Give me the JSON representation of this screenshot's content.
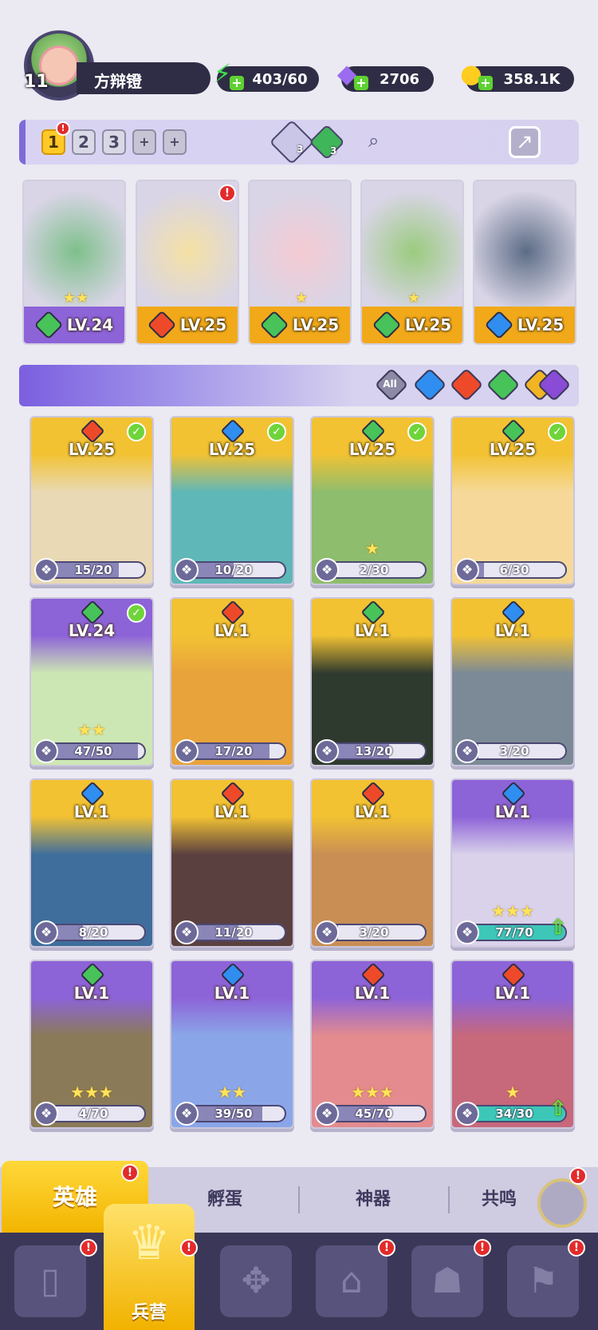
{
  "player": {
    "level": "11",
    "name": "方辩镫"
  },
  "resources": [
    {
      "id": "energy",
      "value": "403/60",
      "icon": "lightning-icon",
      "color": "#3ee04e"
    },
    {
      "id": "gems",
      "value": "2706",
      "icon": "gem-icon",
      "color": "#9a6cf0"
    },
    {
      "id": "gold",
      "value": "358.1K",
      "icon": "coin-icon",
      "color": "#ffcc20"
    }
  ],
  "team": {
    "tabs": [
      "1",
      "2",
      "3",
      "+",
      "+"
    ],
    "active_tab": "1",
    "tab_badge": "!",
    "tickets": [
      {
        "count": "3",
        "color": "#c9c6e8"
      },
      {
        "count": "3",
        "color": "#3fb65a"
      }
    ],
    "members": [
      {
        "level": "LV.24",
        "element": "wind",
        "element_color": "#47c35a",
        "band": "#8d63d8",
        "bg": "#7ec08b",
        "stars": "★★",
        "badge": ""
      },
      {
        "level": "LV.25",
        "element": "fire",
        "element_color": "#ee4a2a",
        "band": "#f1a91a",
        "bg": "#f5e1a4",
        "stars": "",
        "badge": "!"
      },
      {
        "level": "LV.25",
        "element": "wind",
        "element_color": "#47c35a",
        "band": "#f1a91a",
        "bg": "#f5cbd3",
        "stars": "★",
        "badge": ""
      },
      {
        "level": "LV.25",
        "element": "wind",
        "element_color": "#47c35a",
        "band": "#f1a91a",
        "bg": "#9acb7e",
        "stars": "★",
        "badge": ""
      },
      {
        "level": "LV.25",
        "element": "water",
        "element_color": "#2f8ef0",
        "band": "#f1a91a",
        "bg": "#5c6c86",
        "stars": "",
        "badge": ""
      }
    ]
  },
  "filters": [
    {
      "label": "All",
      "color": "#8d8aa6"
    },
    {
      "label": "",
      "color": "#2f8ef0"
    },
    {
      "label": "",
      "color": "#ee4a2a"
    },
    {
      "label": "",
      "color": "#47c35a"
    },
    {
      "label": "",
      "color": "#f1b422"
    },
    {
      "label": "",
      "color": "#8a4bd6"
    }
  ],
  "heroes": [
    {
      "level": "LV.25",
      "element_color": "#ee4a2a",
      "shards": "15/20",
      "progress": 0.75,
      "stars": "",
      "checked": true,
      "upgradeable": false,
      "bg": "#f2c233",
      "art": "#e9d9b4"
    },
    {
      "level": "LV.25",
      "element_color": "#2f8ef0",
      "shards": "10/20",
      "progress": 0.5,
      "stars": "",
      "checked": true,
      "upgradeable": false,
      "bg": "#f2c233",
      "art": "#5fb7b8"
    },
    {
      "level": "LV.25",
      "element_color": "#47c35a",
      "shards": "2/30",
      "progress": 0.07,
      "stars": "★",
      "checked": true,
      "upgradeable": false,
      "bg": "#f2c233",
      "art": "#8ebd6d"
    },
    {
      "level": "LV.25",
      "element_color": "#47c35a",
      "shards": "6/30",
      "progress": 0.2,
      "stars": "",
      "checked": true,
      "upgradeable": false,
      "bg": "#f2c233",
      "art": "#f6d99a"
    },
    {
      "level": "LV.24",
      "element_color": "#47c35a",
      "shards": "47/50",
      "progress": 0.94,
      "stars": "★★",
      "checked": true,
      "upgradeable": false,
      "bg": "#8d63d8",
      "art": "#cde7b4"
    },
    {
      "level": "LV.1",
      "element_color": "#ee4a2a",
      "shards": "17/20",
      "progress": 0.85,
      "stars": "",
      "checked": false,
      "upgradeable": false,
      "bg": "#f2c233",
      "art": "#e8a33b"
    },
    {
      "level": "LV.1",
      "element_color": "#47c35a",
      "shards": "13/20",
      "progress": 0.65,
      "stars": "",
      "checked": false,
      "upgradeable": false,
      "bg": "#f2c233",
      "art": "#2f3a2e"
    },
    {
      "level": "LV.1",
      "element_color": "#2f8ef0",
      "shards": "3/20",
      "progress": 0.15,
      "stars": "",
      "checked": false,
      "upgradeable": false,
      "bg": "#f2c233",
      "art": "#7c8a97"
    },
    {
      "level": "LV.1",
      "element_color": "#2f8ef0",
      "shards": "8/20",
      "progress": 0.4,
      "stars": "",
      "checked": false,
      "upgradeable": false,
      "bg": "#f2c233",
      "art": "#3f6e9c"
    },
    {
      "level": "LV.1",
      "element_color": "#ee4a2a",
      "shards": "11/20",
      "progress": 0.55,
      "stars": "",
      "checked": false,
      "upgradeable": false,
      "bg": "#f2c233",
      "art": "#5b4040"
    },
    {
      "level": "LV.1",
      "element_color": "#ee4a2a",
      "shards": "3/20",
      "progress": 0.15,
      "stars": "",
      "checked": false,
      "upgradeable": false,
      "bg": "#f2c233",
      "art": "#c98e54"
    },
    {
      "level": "LV.1",
      "element_color": "#2f8ef0",
      "shards": "77/70",
      "progress": 1.0,
      "stars": "★★★",
      "checked": false,
      "upgradeable": true,
      "bg": "#8d63d8",
      "art": "#d9d2ea"
    },
    {
      "level": "LV.1",
      "element_color": "#47c35a",
      "shards": "4/70",
      "progress": 0.06,
      "stars": "★★★",
      "checked": false,
      "upgradeable": false,
      "bg": "#8d63d8",
      "art": "#8a7a58"
    },
    {
      "level": "LV.1",
      "element_color": "#2f8ef0",
      "shards": "39/50",
      "progress": 0.78,
      "stars": "★★",
      "checked": false,
      "upgradeable": false,
      "bg": "#8d63d8",
      "art": "#8aa6e8"
    },
    {
      "level": "LV.1",
      "element_color": "#ee4a2a",
      "shards": "45/70",
      "progress": 0.64,
      "stars": "★★★",
      "checked": false,
      "upgradeable": false,
      "bg": "#8d63d8",
      "art": "#e38b8e"
    },
    {
      "level": "LV.1",
      "element_color": "#ee4a2a",
      "shards": "34/30",
      "progress": 1.0,
      "stars": "★",
      "checked": false,
      "upgradeable": true,
      "bg": "#8d63d8",
      "art": "#c7687b"
    }
  ],
  "subtabs": {
    "active": "英雄",
    "items": [
      "孵蛋",
      "神器",
      "共鸣"
    ],
    "badge": "!"
  },
  "bottom_nav": {
    "active_label": "兵营",
    "items": [
      {
        "id": "cards",
        "icon": "cards-icon",
        "glyph": "▯",
        "badge": "!"
      },
      {
        "id": "barracks",
        "icon": "helmet-icon",
        "glyph": "♛",
        "badge": "!"
      },
      {
        "id": "map",
        "icon": "map-icon",
        "glyph": "✥",
        "badge": ""
      },
      {
        "id": "castle",
        "icon": "castle-icon",
        "glyph": "⌂",
        "badge": "!"
      },
      {
        "id": "guild",
        "icon": "mushroom-icon",
        "glyph": "☗",
        "badge": "!"
      },
      {
        "id": "banner",
        "icon": "banner-icon",
        "glyph": "⚑",
        "badge": "!"
      }
    ]
  }
}
